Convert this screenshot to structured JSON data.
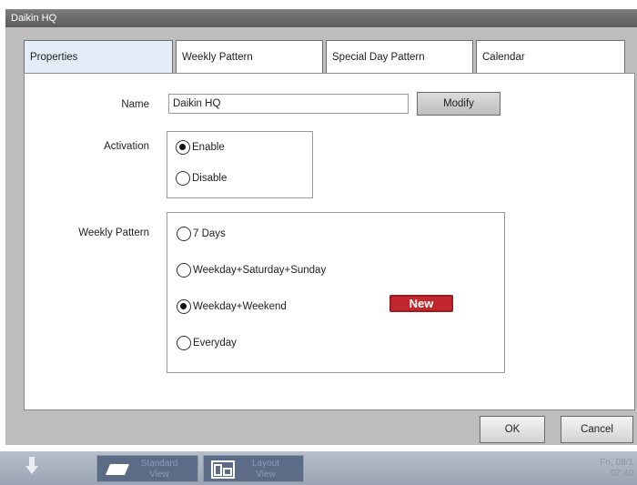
{
  "window": {
    "title": "Daikin HQ"
  },
  "tabs": [
    {
      "label": "Properties",
      "active": true
    },
    {
      "label": "Weekly Pattern",
      "active": false
    },
    {
      "label": "Special Day Pattern",
      "active": false
    },
    {
      "label": "Calendar",
      "active": false
    }
  ],
  "form": {
    "name_label": "Name",
    "name_value": "Daikin HQ",
    "modify_label": "Modify",
    "activation_label": "Activation",
    "activation_options": [
      {
        "label": "Enable",
        "selected": true
      },
      {
        "label": "Disable",
        "selected": false
      }
    ],
    "weekly_pattern_label": "Weekly Pattern",
    "weekly_pattern_options": [
      {
        "label": "7 Days",
        "selected": false
      },
      {
        "label": "Weekday+Saturday+Sunday",
        "selected": false
      },
      {
        "label": "Weekday+Weekend",
        "selected": true
      },
      {
        "label": "Everyday",
        "selected": false
      }
    ],
    "new_badge": "New"
  },
  "footer": {
    "ok_label": "OK",
    "cancel_label": "Cancel"
  },
  "taskbar": {
    "standard_view": {
      "line1": "Standard",
      "line2": "View"
    },
    "layout_view": {
      "line1": "Layout",
      "line2": "View"
    },
    "date": "Fri, 08/1",
    "time": "07:40"
  },
  "colors": {
    "badge": "#c1272d",
    "active_tab": "#e4edf7",
    "window_frame": "#bdbdbd",
    "taskbar_button": "#5c6c86"
  }
}
